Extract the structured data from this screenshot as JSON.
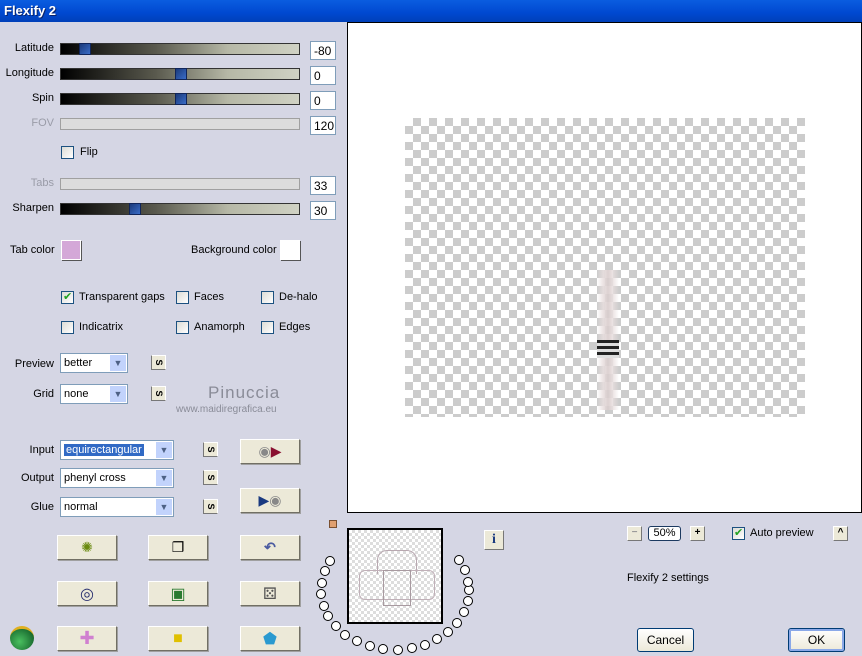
{
  "window": {
    "title": "Flexify 2"
  },
  "sliders": [
    {
      "label": "Latitude",
      "value": "-80",
      "fraction": 0.08,
      "enabled": true
    },
    {
      "label": "Longitude",
      "value": "0",
      "fraction": 0.5,
      "enabled": true
    },
    {
      "label": "Spin",
      "value": "0",
      "fraction": 0.5,
      "enabled": true
    },
    {
      "label": "FOV",
      "value": "120",
      "enabled": false
    },
    {
      "label": "Tabs",
      "value": "33",
      "enabled": false
    },
    {
      "label": "Sharpen",
      "value": "30",
      "fraction": 0.3,
      "enabled": true
    }
  ],
  "flip": {
    "label": "Flip",
    "checked": false
  },
  "colors": {
    "tab_label": "Tab color",
    "tab_color": "#d4a8d8",
    "bg_label": "Background color",
    "bg_color": "#ffffff"
  },
  "options": [
    {
      "label": "Transparent gaps",
      "checked": true
    },
    {
      "label": "Faces",
      "checked": false
    },
    {
      "label": "De-halo",
      "checked": false
    },
    {
      "label": "Indicatrix",
      "checked": false
    },
    {
      "label": "Anamorph",
      "checked": false
    },
    {
      "label": "Edges",
      "checked": false
    }
  ],
  "preview_select": {
    "label": "Preview",
    "value": "better"
  },
  "grid_select": {
    "label": "Grid",
    "value": "none"
  },
  "s_label": "S",
  "watermark": {
    "name": "Pinuccia",
    "url": "www.maidiregrafica.eu"
  },
  "input_select": {
    "label": "Input",
    "value": "equirectangular"
  },
  "output_select": {
    "label": "Output",
    "value": "phenyl cross"
  },
  "glue_select": {
    "label": "Glue",
    "value": "normal"
  },
  "zoom": {
    "minus": "−",
    "value": "50%",
    "plus": "+"
  },
  "auto_preview": {
    "label": "Auto preview",
    "checked": true
  },
  "collapse_label": "^",
  "info_label": "i",
  "settings_text": "Flexify 2 settings",
  "buttons": {
    "cancel": "Cancel",
    "ok": "OK"
  }
}
